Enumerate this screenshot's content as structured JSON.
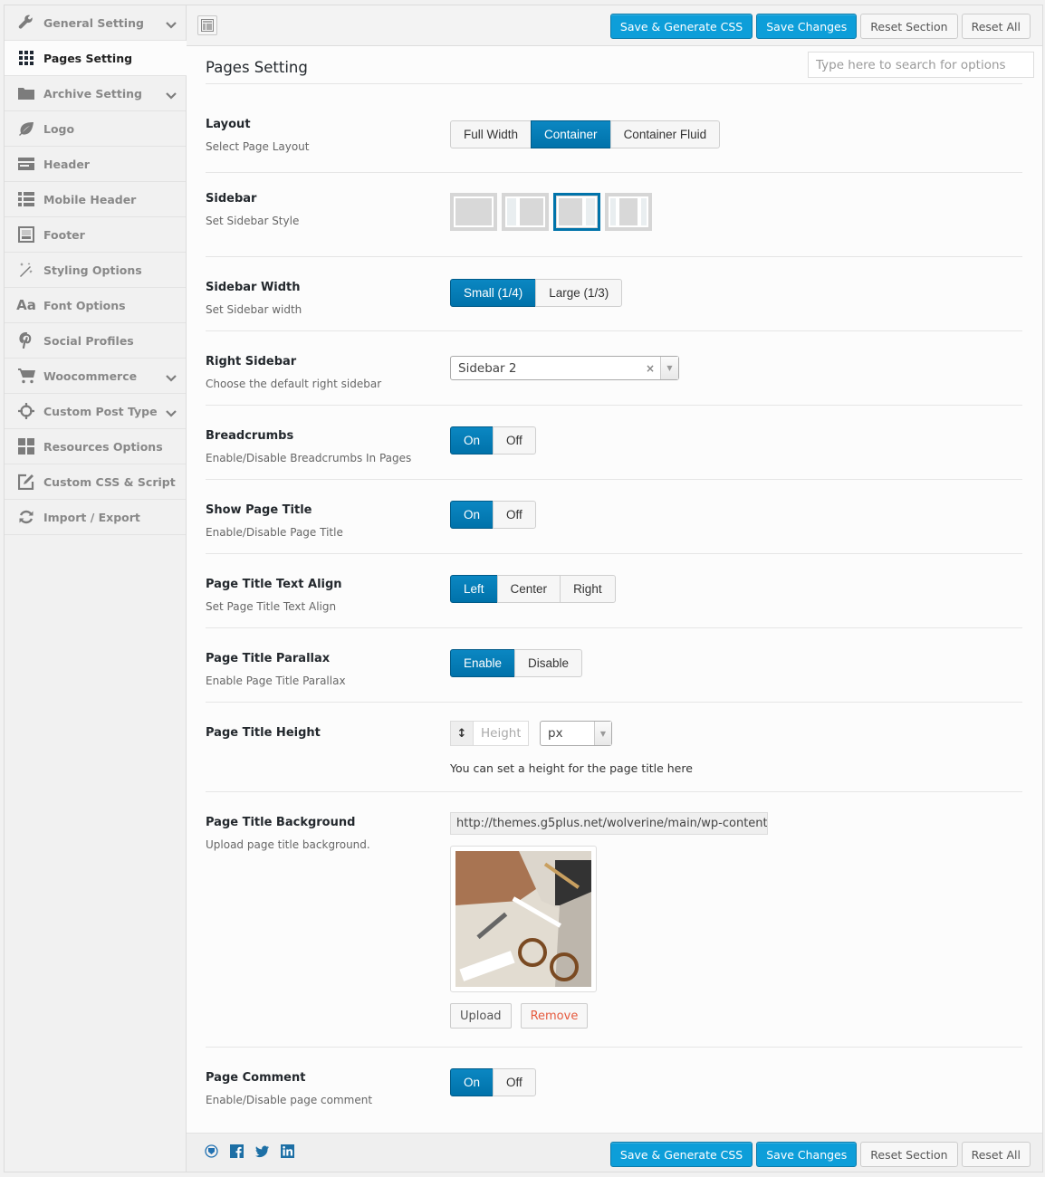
{
  "sidebar": {
    "items": [
      {
        "label": "General Setting",
        "icon": "wrench-icon",
        "has_children": true,
        "active": false
      },
      {
        "label": "Pages Setting",
        "icon": "grid-icon",
        "has_children": false,
        "active": true
      },
      {
        "label": "Archive Setting",
        "icon": "folder-icon",
        "has_children": true,
        "active": false
      },
      {
        "label": "Logo",
        "icon": "leaf-icon",
        "has_children": false,
        "active": false
      },
      {
        "label": "Header",
        "icon": "header-icon",
        "has_children": false,
        "active": false
      },
      {
        "label": "Mobile Header",
        "icon": "list-icon",
        "has_children": false,
        "active": false
      },
      {
        "label": "Footer",
        "icon": "footer-icon",
        "has_children": false,
        "active": false
      },
      {
        "label": "Styling Options",
        "icon": "magic-wand-icon",
        "has_children": false,
        "active": false
      },
      {
        "label": "Font Options",
        "icon": "font-icon",
        "has_children": false,
        "active": false
      },
      {
        "label": "Social Profiles",
        "icon": "pinterest-icon",
        "has_children": false,
        "active": false
      },
      {
        "label": "Woocommerce",
        "icon": "cart-icon",
        "has_children": true,
        "active": false
      },
      {
        "label": "Custom Post Type",
        "icon": "crosshair-icon",
        "has_children": true,
        "active": false
      },
      {
        "label": "Resources Options",
        "icon": "tiles-icon",
        "has_children": false,
        "active": false
      },
      {
        "label": "Custom CSS & Script",
        "icon": "edit-icon",
        "has_children": false,
        "active": false
      },
      {
        "label": "Import / Export",
        "icon": "refresh-icon",
        "has_children": false,
        "active": false
      }
    ]
  },
  "toolbar": {
    "save_generate_label": "Save & Generate CSS",
    "save_label": "Save Changes",
    "reset_section_label": "Reset Section",
    "reset_all_label": "Reset All"
  },
  "search": {
    "placeholder": "Type here to search for options",
    "value": ""
  },
  "section": {
    "title": "Pages Setting"
  },
  "options": {
    "layout": {
      "title": "Layout",
      "desc": "Select Page Layout",
      "choices": [
        "Full Width",
        "Container",
        "Container Fluid"
      ],
      "selected": "Container"
    },
    "sidebar": {
      "title": "Sidebar",
      "desc": "Set Sidebar Style",
      "choices": [
        "none",
        "left",
        "right",
        "both"
      ],
      "selected": "right"
    },
    "sidebar_width": {
      "title": "Sidebar Width",
      "desc": "Set Sidebar width",
      "choices": [
        "Small (1/4)",
        "Large (1/3)"
      ],
      "selected": "Small (1/4)"
    },
    "right_sidebar": {
      "title": "Right Sidebar",
      "desc": "Choose the default right sidebar",
      "value": "Sidebar 2",
      "clear": "×",
      "arrow": "▼"
    },
    "breadcrumbs": {
      "title": "Breadcrumbs",
      "desc": "Enable/Disable Breadcrumbs In Pages",
      "on": "On",
      "off": "Off",
      "selected": "On"
    },
    "show_page_title": {
      "title": "Show Page Title",
      "desc": "Enable/Disable Page Title",
      "on": "On",
      "off": "Off",
      "selected": "On"
    },
    "title_align": {
      "title": "Page Title Text Align",
      "desc": "Set Page Title Text Align",
      "choices": [
        "Left",
        "Center",
        "Right"
      ],
      "selected": "Left"
    },
    "parallax": {
      "title": "Page Title Parallax",
      "desc": "Enable Page Title Parallax",
      "choices": [
        "Enable",
        "Disable"
      ],
      "selected": "Enable"
    },
    "title_height": {
      "title": "Page Title Height",
      "placeholder": "Height",
      "value": "",
      "unit": "px",
      "addon": "↕",
      "help": "You can set a height for the page title here"
    },
    "title_background": {
      "title": "Page Title Background",
      "desc": "Upload page title background.",
      "url": "http://themes.g5plus.net/wolverine/main/wp-content",
      "upload_label": "Upload",
      "remove_label": "Remove"
    },
    "page_comment": {
      "title": "Page Comment",
      "desc": "Enable/Disable page comment",
      "on": "On",
      "off": "Off",
      "selected": "On"
    }
  },
  "footer": {
    "social": [
      "redux-icon",
      "facebook-icon",
      "twitter-icon",
      "linkedin-icon"
    ]
  },
  "colors": {
    "primary": "#0d9ed9",
    "toggle_active": "#0073aa",
    "remove": "#e65a3e"
  }
}
